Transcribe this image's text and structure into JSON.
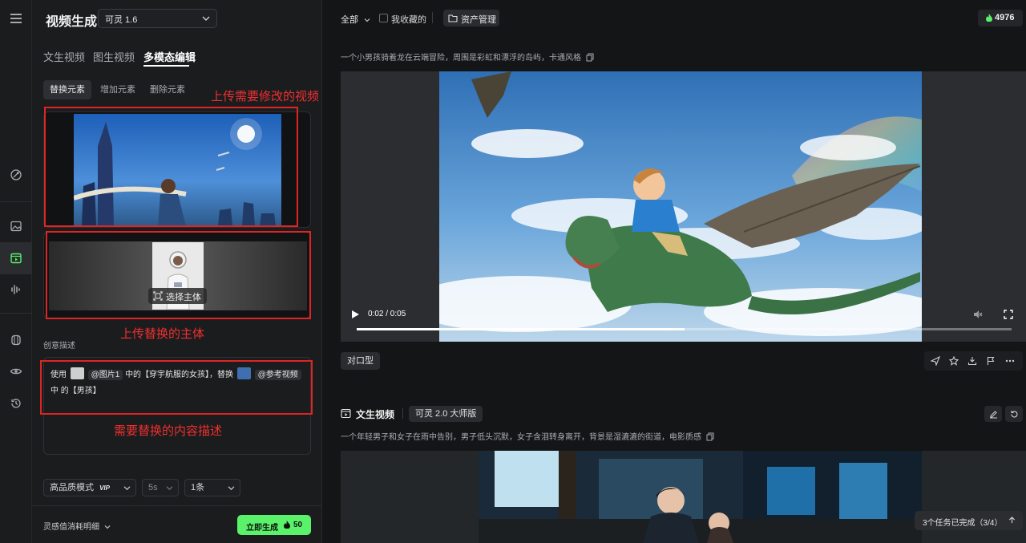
{
  "sidebar": {
    "title": "视频生成",
    "model_select": "可灵 1.6"
  },
  "tabs": [
    "文生视频",
    "图生视频",
    "多模态编辑"
  ],
  "subtabs": [
    "替换元素",
    "增加元素",
    "删除元素"
  ],
  "annotations": {
    "upload_video": "上传需要修改的视频",
    "upload_subject": "上传替换的主体",
    "describe_replace": "需要替换的内容描述"
  },
  "subject_button": "选择主体",
  "creative": {
    "label": "创意描述",
    "prefix": "使用",
    "ref1": "@图片1",
    "mid1": "中的【穿宇航服的女孩】，替换",
    "ref2": "@参考视频",
    "mid2": "中",
    "end": "的【男孩】"
  },
  "settings": {
    "quality": "高品质模式",
    "vip": "VIP",
    "duration": "5s",
    "count": "1条"
  },
  "footer": {
    "cost_detail": "灵感值消耗明细",
    "generate": "立即生成",
    "cost": "50"
  },
  "topbar": {
    "filter_all": "全部",
    "favorites": "我收藏的",
    "asset_manage": "资产管理",
    "credits": "4976"
  },
  "item1": {
    "prompt": "一个小男孩骑着龙在云端冒险，周围是彩虹和漂浮的岛屿，卡通风格",
    "time": "0:02 / 0:05",
    "progress": 0.5,
    "lip_sync": "对口型"
  },
  "item2": {
    "type": "文生视频",
    "model_badge": "可灵 2.0 大师版",
    "prompt": "一个年轻男子和女子在雨中告别，男子低头沉默，女子含泪转身离开，背景是湿漉漉的街道，电影质感"
  },
  "tasks": "3个任务已完成（3/4）",
  "colors": {
    "accent_green": "#5af26a",
    "annotation_red": "#e02424",
    "panel": "#1b1c1e",
    "background": "#141516"
  }
}
